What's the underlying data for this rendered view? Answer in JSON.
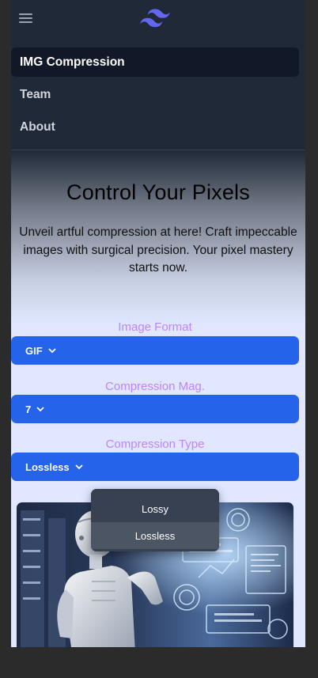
{
  "nav": {
    "items": [
      {
        "label": "IMG Compression",
        "active": true
      },
      {
        "label": "Team",
        "active": false
      },
      {
        "label": "About",
        "active": false
      }
    ],
    "menu_icon": "hamburger-icon",
    "logo_icon": "wave-logo-icon"
  },
  "hero": {
    "title": "Control Your Pixels",
    "text": "Unveil artful compression at here! Craft impeccable images with surgical precision. Your pixel mastery starts now."
  },
  "form": {
    "format": {
      "label": "Image Format",
      "value": "GIF"
    },
    "magnitude": {
      "label": "Compression Mag.",
      "value": "7"
    },
    "type": {
      "label": "Compression Type",
      "value": "Lossless",
      "options": [
        "Lossy",
        "Lossless"
      ]
    }
  },
  "colors": {
    "nav_bg": "#1f2937",
    "accent": "#2563eb",
    "label": "#c084fc",
    "page_bg": "#e0e7ff",
    "logo": "#6366f1"
  }
}
